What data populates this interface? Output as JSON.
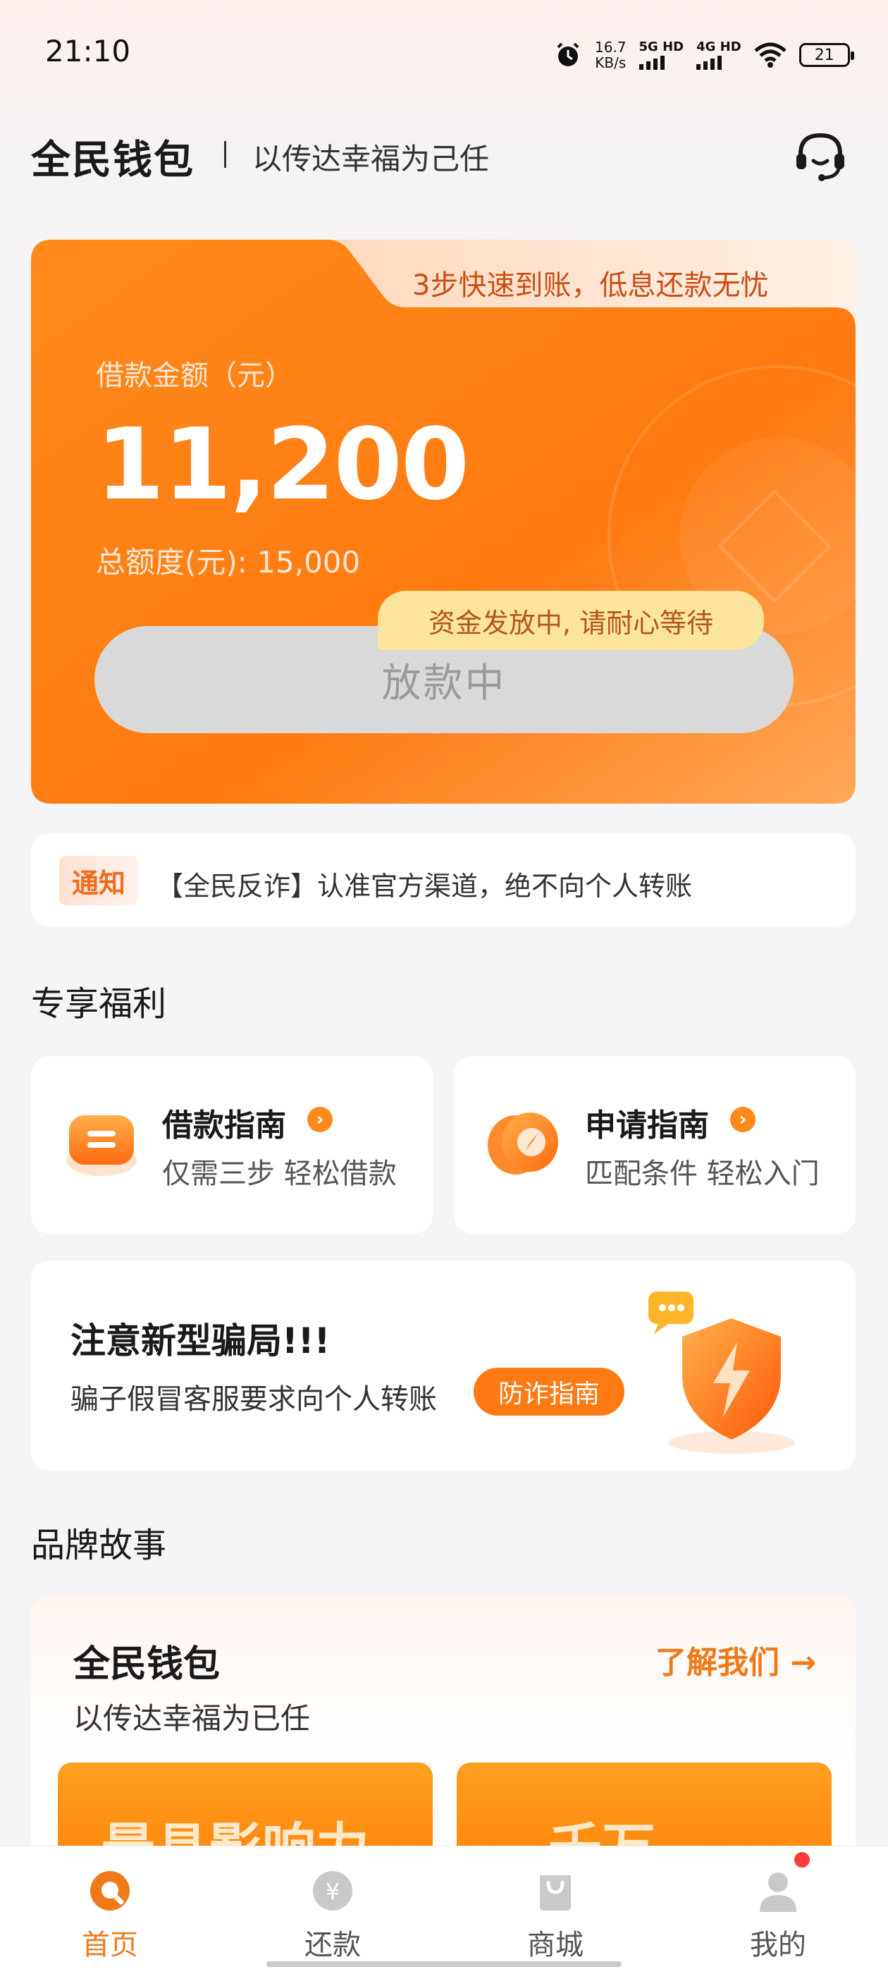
{
  "status_bar": {
    "time": "21:10",
    "net_speed_value": "16.7",
    "net_speed_unit": "KB/s",
    "signal1_label": "5G HD",
    "signal2_label": "4G HD",
    "battery": "21",
    "icons": [
      "alarm-icon",
      "signal-icon",
      "wifi-icon",
      "battery-icon"
    ]
  },
  "header": {
    "app_name": "全民钱包",
    "slogan": "以传达幸福为己任",
    "support_icon": "headset-icon"
  },
  "loan_card": {
    "promo": "3步快速到账，低息还款无忧",
    "amount_label": "借款金额（元）",
    "amount": "11,200",
    "total_quota": "总额度(元): 15,000",
    "tip": "资金发放中, 请耐心等待",
    "button_label": "放款中",
    "colors": {
      "card": "#ff7a12",
      "card_light": "#ffa85a",
      "button_disabled": "#d9d9d9",
      "tip_bg": "#fde49c"
    }
  },
  "notice": {
    "tag": "通知",
    "text": "【全民反诈】认准官方渠道，绝不向个人转账"
  },
  "benefits": {
    "title": "专享福利",
    "items": [
      {
        "title": "借款指南",
        "subtitle": "仅需三步 轻松借款",
        "icon": "loan-guide-icon"
      },
      {
        "title": "申请指南",
        "subtitle": "匹配条件 轻松入门",
        "icon": "compass-icon"
      }
    ]
  },
  "fraud_alert": {
    "title": "注意新型骗局!!!",
    "text": "骗子假冒客服要求向个人转账",
    "button": "防诈指南",
    "icon": "shield-lightning-icon"
  },
  "brand": {
    "section_title": "品牌故事",
    "name": "全民钱包",
    "slogan": "以传达幸福为已任",
    "link": "了解我们 →",
    "banner_left": "最具影响力",
    "banner_right": "千万"
  },
  "bottom_nav": {
    "items": [
      {
        "label": "首页",
        "icon": "home-icon",
        "active": true
      },
      {
        "label": "还款",
        "icon": "repay-icon",
        "active": false
      },
      {
        "label": "商城",
        "icon": "shop-bag-icon",
        "active": false
      },
      {
        "label": "我的",
        "icon": "profile-icon",
        "active": false
      }
    ],
    "active_color": "#f07a1a",
    "inactive_color": "#555555"
  }
}
